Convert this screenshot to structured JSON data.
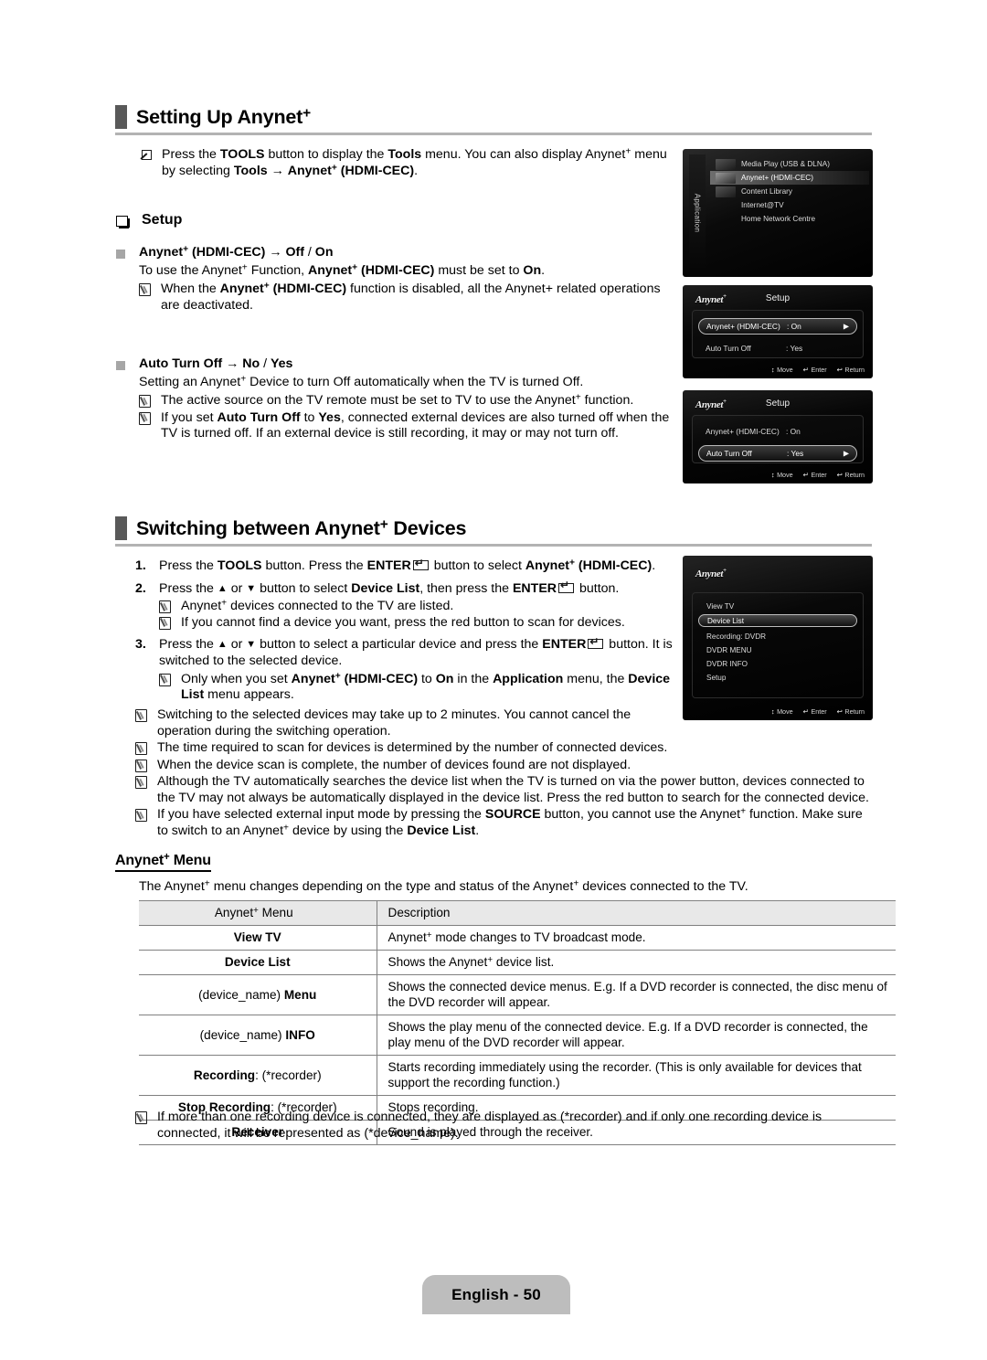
{
  "document": {
    "page_label": "English - 50"
  },
  "sections": [
    {
      "id": "setting_up",
      "title": "Setting Up Anynet",
      "title_sup": "+",
      "intro_note": {
        "icon": "press-icon",
        "text_parts": [
          {
            "t": "Press the "
          },
          {
            "t": "TOOLS",
            "b": true
          },
          {
            "t": " button to display the "
          },
          {
            "t": "Tools",
            "b": true
          },
          {
            "t": " menu. You can also display Anynet"
          },
          {
            "t": "+",
            "sup": true
          },
          {
            "t": " menu by selecting "
          },
          {
            "t": "Tools",
            "b": true
          },
          {
            "t": " → "
          },
          {
            "t": "Anynet",
            "b": true
          },
          {
            "t": "+",
            "sup": true,
            "b": true
          },
          {
            "t": " (HDMI-CEC)",
            "b": true
          },
          {
            "t": "."
          }
        ]
      },
      "setup_label": "Setup",
      "items": [
        {
          "heading": "Anynet+ (HDMI-CEC) → Off / On",
          "lead": "To use the Anynet+ Function, Anynet+ (HDMI-CEC) must be set to On.",
          "notes": [
            "When the Anynet+ (HDMI-CEC) function is disabled, all the Anynet+ related operations are deactivated."
          ]
        },
        {
          "heading": "Auto Turn Off → No / Yes",
          "lead": "Setting an Anynet+ Device to turn Off automatically when the TV is turned Off.",
          "notes": [
            "The active source on the TV remote must be set to TV to use the Anynet+ function.",
            "If you set Auto Turn Off to Yes, connected external devices are also turned off when the TV is turned off. If an external device is still recording, it may or may not turn off."
          ]
        }
      ]
    },
    {
      "id": "switching",
      "title": "Switching between Anynet",
      "title_sup": "+",
      "title_tail": " Devices",
      "steps": [
        {
          "num": "1.",
          "text": "Press the TOOLS button. Press the ENTER button to select Anynet+ (HDMI-CEC)."
        },
        {
          "num": "2.",
          "text": "Press the ▲ or ▼ button to select Device List, then press the ENTER button.",
          "notes": [
            "Anynet+ devices connected to the TV are listed.",
            "If you cannot find a device you want, press the red button to scan for devices."
          ]
        },
        {
          "num": "3.",
          "text": "Press the ▲ or ▼ button to select a particular device and press the ENTER button. It is switched to the selected device.",
          "notes": [
            "Only when you set Anynet+ (HDMI-CEC) to On in the Application menu, the Device List menu appears."
          ]
        }
      ],
      "trailing_notes": [
        "Switching to the selected devices may take up to 2 minutes. You cannot cancel the operation during the switching operation.",
        "The time required to scan for devices is determined by the number of connected devices.",
        "When the device scan is complete, the number of devices found are not displayed.",
        "Although the TV automatically searches the device list when the TV is turned on via the power button, devices connected to the TV may not always be automatically displayed in the device list. Press the red button to search for the connected device.",
        "If you have selected external input mode by pressing the SOURCE button, you cannot use the Anynet+ function. Make sure to switch to an Anynet+ device by using the Device List."
      ]
    },
    {
      "id": "anynet_menu",
      "title": "Anynet+ Menu",
      "intro": "The Anynet+ menu changes depending on the type and status of the Anynet+ devices connected to the TV.",
      "table": {
        "headers": [
          "Anynet+ Menu",
          "Description"
        ],
        "rows": [
          {
            "menu": "View TV",
            "desc": "Anynet+ mode changes to TV broadcast mode."
          },
          {
            "menu": "Device List",
            "desc": "Shows the Anynet+ device list."
          },
          {
            "menu": "(device_name) Menu",
            "desc": "Shows the connected device menus. E.g. If a DVD recorder is connected, the disc menu of the DVD recorder will appear."
          },
          {
            "menu": "(device_name) INFO",
            "desc": "Shows the play menu of the connected device. E.g. If a DVD recorder is connected, the play menu of the DVD recorder will appear."
          },
          {
            "menu": "Recording: (*recorder)",
            "desc": "Starts recording immediately using the recorder. (This is only available for devices that support the recording function.)"
          },
          {
            "menu": "Stop Recording: (*recorder)",
            "desc": "Stops recording."
          },
          {
            "menu": "Receiver",
            "desc": "Sound is played through the receiver."
          }
        ]
      },
      "footer_note": "If more than one recording device is connected, they are displayed as (*recorder) and if only one recording device is connected, it will be represented as (*device_name)."
    }
  ],
  "screens": {
    "application": {
      "rail_label": "Application",
      "items": [
        {
          "label": "Media Play (USB & DLNA)",
          "selected": false,
          "has_thumb": true
        },
        {
          "label": "Anynet+ (HDMI-CEC)",
          "selected": true,
          "has_thumb": true
        },
        {
          "label": "Content Library",
          "selected": false,
          "has_thumb": true
        },
        {
          "label": "Internet@TV",
          "selected": false,
          "has_thumb": false
        },
        {
          "label": "Home Network Centre",
          "selected": false,
          "has_thumb": false
        }
      ]
    },
    "setup_1": {
      "logo": "Anynet",
      "logo_sup": "+",
      "title": "Setup",
      "rows": [
        {
          "label": "Anynet+ (HDMI-CEC)",
          "value": ": On",
          "selected": true
        },
        {
          "label": "Auto Turn Off",
          "value": ": Yes",
          "selected": false
        }
      ],
      "footer": [
        {
          "glyph": "↕",
          "label": "Move"
        },
        {
          "glyph": "↵",
          "label": "Enter"
        },
        {
          "glyph": "↩",
          "label": "Return"
        }
      ]
    },
    "setup_2": {
      "logo": "Anynet",
      "logo_sup": "+",
      "title": "Setup",
      "rows": [
        {
          "label": "Anynet+ (HDMI-CEC)",
          "value": ": On",
          "selected": false
        },
        {
          "label": "Auto Turn Off",
          "value": ": Yes",
          "selected": true
        }
      ],
      "footer": [
        {
          "glyph": "↕",
          "label": "Move"
        },
        {
          "glyph": "↵",
          "label": "Enter"
        },
        {
          "glyph": "↩",
          "label": "Return"
        }
      ]
    },
    "anynet_menu_screen": {
      "logo": "Anynet",
      "logo_sup": "+",
      "items": [
        {
          "label": "View TV",
          "selected": false
        },
        {
          "label": "Device List",
          "selected": true
        },
        {
          "label": "Recording: DVDR",
          "selected": false
        },
        {
          "label": "DVDR MENU",
          "selected": false
        },
        {
          "label": "DVDR INFO",
          "selected": false
        },
        {
          "label": "Setup",
          "selected": false
        }
      ],
      "footer": [
        {
          "glyph": "↕",
          "label": "Move"
        },
        {
          "glyph": "↵",
          "label": "Enter"
        },
        {
          "glyph": "↩",
          "label": "Return"
        }
      ]
    }
  }
}
